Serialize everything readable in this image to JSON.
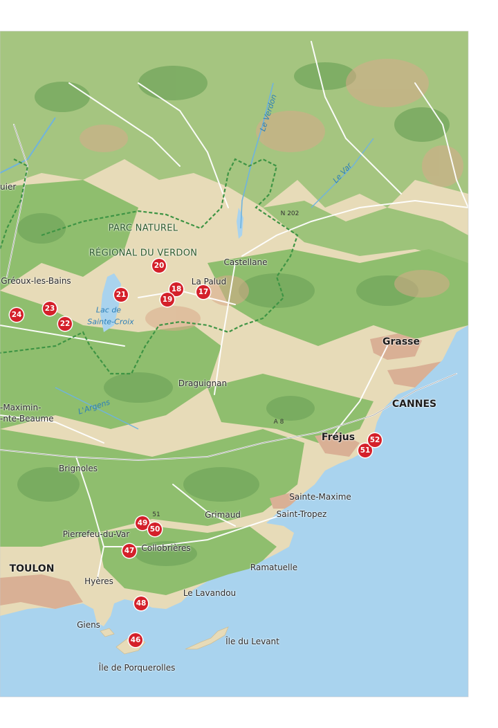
{
  "towns_major": [
    "TOULON",
    "CANNES",
    "Grasse",
    "Fréjus"
  ],
  "towns": [
    "Gréoux-les-Bains",
    "Castellane",
    "La Palud",
    "Draguignan",
    "Brignoles",
    "Pierrefeu-du-Var",
    "Collobrières",
    "Grimaud",
    "Sainte-Maxime",
    "Saint-Tropez",
    "Ramatuelle",
    "Le Lavandou",
    "Hyères",
    "Giens",
    "Île de Porquerolles",
    "Île du Levant",
    "-Maximin-",
    "-nte-Beaume",
    "uier"
  ],
  "water": [
    "Le Verdon",
    "Le Var",
    "L'Argens",
    "Lac de",
    "Sainte-Croix"
  ],
  "park": [
    "PARC NATUREL",
    "RÉGIONAL DU VERDON"
  ],
  "roads": [
    "N 202",
    "A 8",
    "51"
  ],
  "markers": [
    "17",
    "18",
    "19",
    "20",
    "21",
    "22",
    "23",
    "24",
    "46",
    "47",
    "48",
    "49",
    "50",
    "51",
    "52"
  ],
  "colors": {
    "sea": "#a9d3ee",
    "land": "#e7dbb8",
    "forest": "#8fbe6e",
    "forest_dark": "#6fa45a",
    "relief": "#d9a98a",
    "urban": "#d9b095",
    "road": "#ffffff",
    "park_boundary": "#3e9444",
    "marker": "#d4202a"
  }
}
